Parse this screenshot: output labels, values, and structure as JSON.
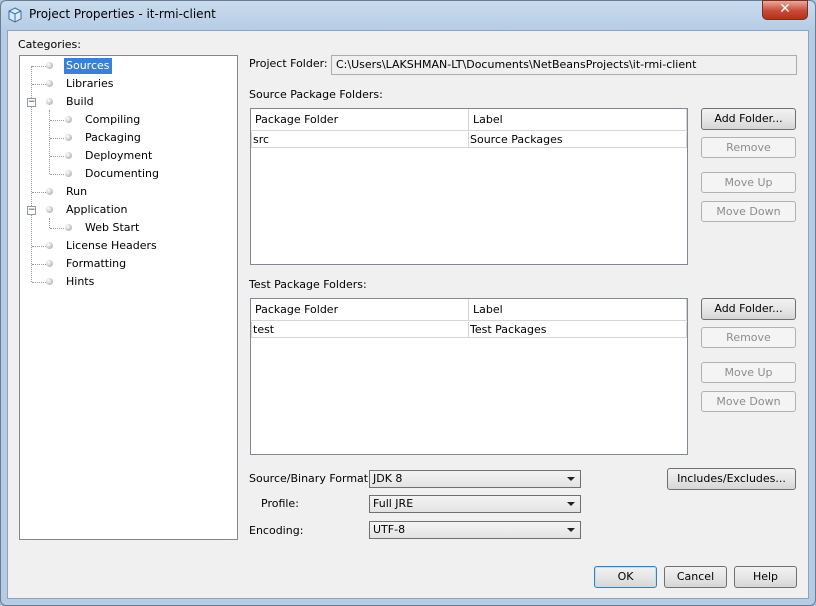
{
  "window": {
    "title": "Project Properties - it-rmi-client",
    "close_label": "✕"
  },
  "categories": {
    "label": "Categories:",
    "items": [
      {
        "label": "Sources"
      },
      {
        "label": "Libraries"
      },
      {
        "label": "Build"
      },
      {
        "label": "Compiling"
      },
      {
        "label": "Packaging"
      },
      {
        "label": "Deployment"
      },
      {
        "label": "Documenting"
      },
      {
        "label": "Run"
      },
      {
        "label": "Application"
      },
      {
        "label": "Web Start"
      },
      {
        "label": "License Headers"
      },
      {
        "label": "Formatting"
      },
      {
        "label": "Hints"
      }
    ],
    "selected": "Sources"
  },
  "project_folder": {
    "label": "Project Folder:",
    "value": "C:\\Users\\LAKSHMAN-LT\\Documents\\NetBeansProjects\\it-rmi-client"
  },
  "source_packages": {
    "label": "Source Package Folders:",
    "columns": [
      "Package Folder",
      "Label"
    ],
    "rows": [
      {
        "folder": "src",
        "label": "Source Packages"
      }
    ],
    "buttons": {
      "add": "Add Folder...",
      "remove": "Remove",
      "move_up": "Move Up",
      "move_down": "Move Down"
    }
  },
  "test_packages": {
    "label": "Test Package Folders:",
    "columns": [
      "Package Folder",
      "Label"
    ],
    "rows": [
      {
        "folder": "test",
        "label": "Test Packages"
      }
    ],
    "buttons": {
      "add": "Add Folder...",
      "remove": "Remove",
      "move_up": "Move Up",
      "move_down": "Move Down"
    }
  },
  "format": {
    "source_binary_label": "Source/Binary Format:",
    "source_binary_value": "JDK 8",
    "profile_label": "Profile:",
    "profile_value": "Full JRE",
    "encoding_label": "Encoding:",
    "encoding_value": "UTF-8",
    "includes_button": "Includes/Excludes..."
  },
  "footer": {
    "ok": "OK",
    "cancel": "Cancel",
    "help": "Help"
  }
}
